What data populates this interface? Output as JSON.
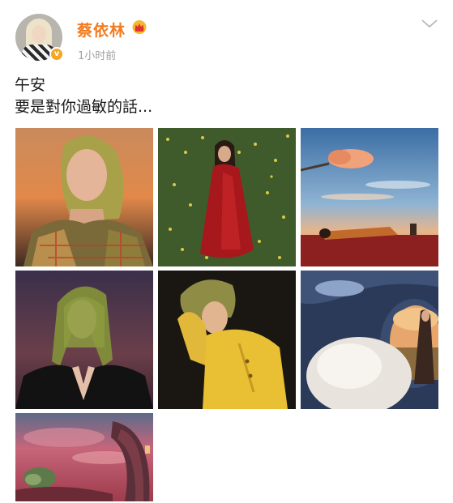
{
  "post": {
    "username": "蔡依林",
    "timestamp": "1小时前",
    "content_lines": [
      "午安",
      "要是對你過敏的話..."
    ],
    "accent_color": "#f47b20",
    "vip_icon": "crown-icon",
    "verified_icon": "verified-badge-icon",
    "more_icon": "chevron-down-icon"
  },
  "photos": [
    {
      "name": "photo-1",
      "subject": "woman-plaid-coat-sunset"
    },
    {
      "name": "photo-2",
      "subject": "woman-red-dress-flower-field"
    },
    {
      "name": "photo-3",
      "subject": "woman-lying-orange-cloud-sky"
    },
    {
      "name": "photo-4",
      "subject": "woman-green-hair-black-suit"
    },
    {
      "name": "photo-5",
      "subject": "woman-yellow-shirt"
    },
    {
      "name": "photo-6",
      "subject": "woman-portal-fluffy-sphere"
    },
    {
      "name": "photo-7",
      "subject": "pink-sky-surreal-scene"
    }
  ]
}
